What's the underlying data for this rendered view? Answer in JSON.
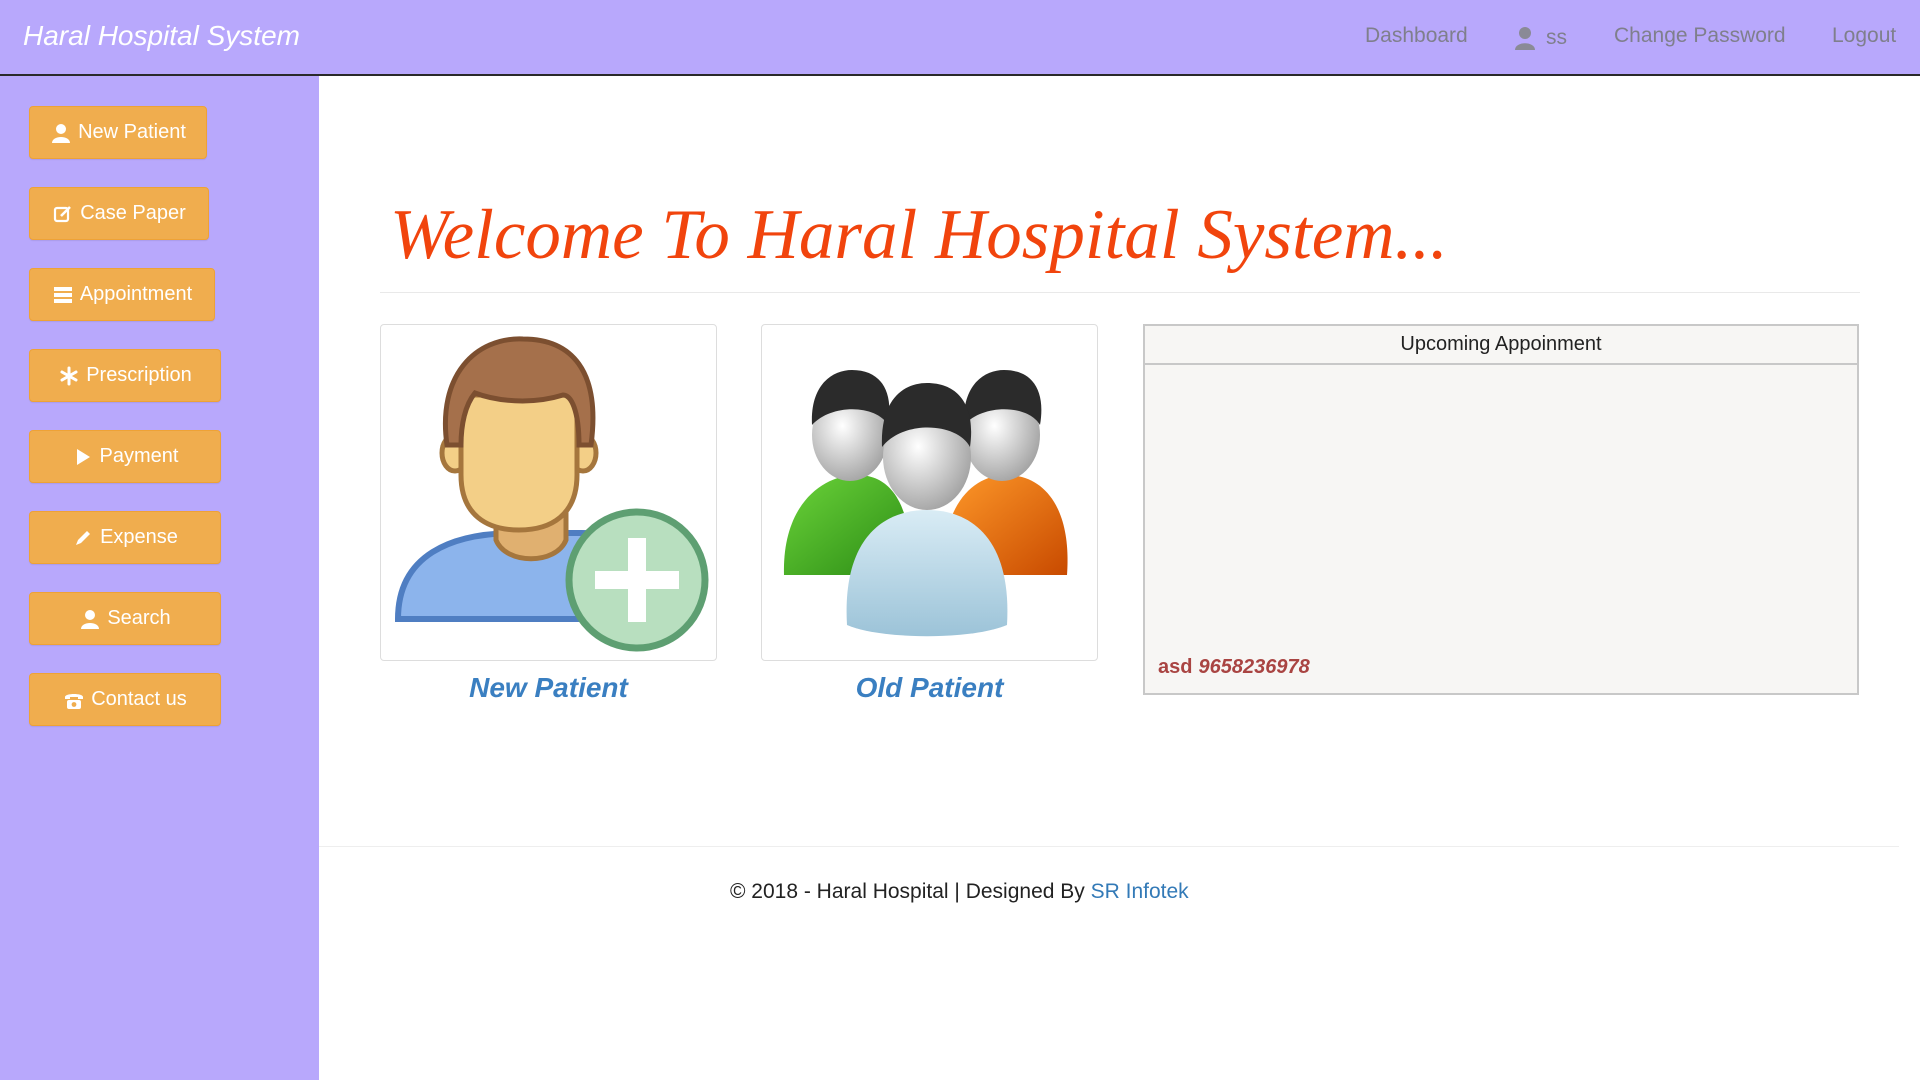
{
  "header": {
    "brand": "Haral Hospital System",
    "nav": {
      "dashboard": "Dashboard",
      "user": "ss",
      "change_password": "Change Password",
      "logout": "Logout"
    }
  },
  "sidebar": {
    "items": [
      {
        "label": "New Patient",
        "icon": "user-icon"
      },
      {
        "label": "Case Paper",
        "icon": "edit-icon"
      },
      {
        "label": "Appointment",
        "icon": "list-icon"
      },
      {
        "label": "Prescription",
        "icon": "asterisk-icon"
      },
      {
        "label": "Payment",
        "icon": "play-icon"
      },
      {
        "label": "Expense",
        "icon": "pencil-icon"
      },
      {
        "label": "Search",
        "icon": "user-icon"
      },
      {
        "label": "Contact us",
        "icon": "phone-icon"
      }
    ]
  },
  "main": {
    "welcome": "Welcome To Haral Hospital System...",
    "cards": {
      "new_patient": "New Patient",
      "old_patient": "Old Patient"
    },
    "appointments": {
      "title": "Upcoming Appoinment",
      "items": [
        {
          "name": "asd",
          "phone": "9658236978"
        }
      ]
    }
  },
  "footer": {
    "text": "© 2018 - Haral Hospital | Designed By",
    "link": "SR Infotek"
  },
  "colors": {
    "bar": "#b8a8fc",
    "button": "#f0ad4e",
    "welcome": "#f1440d",
    "caption": "#3a7fc1",
    "appointment_text": "#a94442"
  }
}
